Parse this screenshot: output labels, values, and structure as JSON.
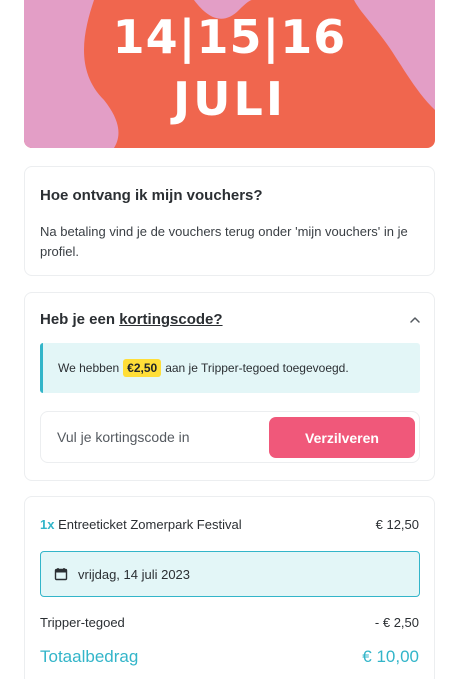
{
  "hero": {
    "dates": "14|15|16",
    "month": "JULI",
    "colors": {
      "background": "#f0664e",
      "blob": "#e39ec6"
    }
  },
  "info": {
    "title": "Hoe ontvang ik mijn vouchers?",
    "text": "Na betaling vind je de vouchers terug onder 'mijn vouchers' in je profiel."
  },
  "discount": {
    "title_prefix": "Heb je een ",
    "title_link": "kortingscode?",
    "toggle_icon": "chevron-up-icon",
    "alert": {
      "prefix": "We hebben",
      "amount": "€2,50",
      "suffix": "aan je Tripper-tegoed toegevoegd."
    },
    "input": {
      "placeholder": "Vul je kortingscode in",
      "value": ""
    },
    "button_label": "Verzilveren"
  },
  "summary": {
    "ticket": {
      "quantity": "1x",
      "name": "Entreeticket Zomerpark Festival",
      "price": "€ 12,50"
    },
    "date": {
      "icon": "calendar-icon",
      "label": "vrijdag, 14 juli 2023"
    },
    "credit": {
      "label": "Tripper-tegoed",
      "value": "- € 2,50"
    },
    "total": {
      "label": "Totaalbedrag",
      "value": "€ 10,00"
    }
  },
  "colors": {
    "accent": "#33b5c9",
    "button": "#f0587a",
    "highlight": "#ffde38",
    "alert_bg": "#e3f6f7"
  }
}
